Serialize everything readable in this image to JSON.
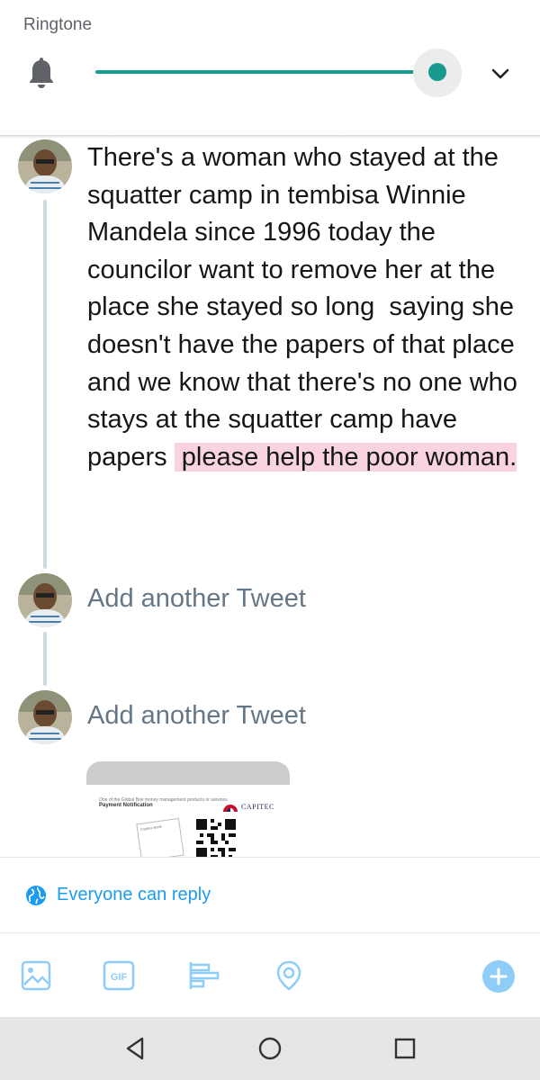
{
  "volume_panel": {
    "title": "Ringtone",
    "icon": "bell-icon",
    "level_fraction": 0.98,
    "accent_color": "#1a9a8e",
    "expand_icon": "chevron-down-icon"
  },
  "thread": {
    "tweet_text_plain": "There's a woman who stayed at the squatter camp in tembisa Winnie Mandela since 1996 today the councilor want to remove her at the place she stayed so long  saying she doesn't have the papers of that place and we know that there's no one who stays at the squatter camp have papers ",
    "tweet_text_highlighted": " please help the poor woman.",
    "highlight_color": "#f9d4df",
    "placeholders": [
      "Add another Tweet",
      "Add another Tweet"
    ]
  },
  "attachment": {
    "doc_tiny_text": "One of the Global Brei money management products or services",
    "doc_heading": "Payment Notification",
    "brand": "CAPITEC",
    "stamp_text": "Capitec Bank"
  },
  "reply_setting": {
    "label": "Everyone can reply",
    "icon": "globe-icon",
    "color": "#1d9bf0"
  },
  "toolbar": {
    "icons": [
      "image-icon",
      "gif-icon",
      "poll-icon",
      "location-icon",
      "add-icon"
    ],
    "gif_label": "GIF"
  },
  "navbar": {
    "icons": [
      "back-icon",
      "home-icon",
      "recents-icon"
    ]
  }
}
